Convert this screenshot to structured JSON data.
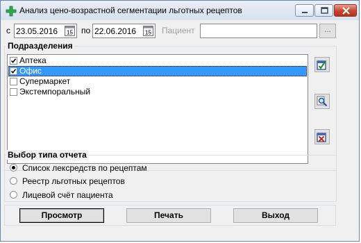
{
  "window": {
    "title": "Анализ цено-возрастной сегментации льготных рецептов"
  },
  "filters": {
    "from_label": "с",
    "from_date": "23.05.2016",
    "to_label": "по",
    "to_date": "22.06.2016",
    "calendar_glyph": "15",
    "patient_label": "Пациент",
    "patient_value": "",
    "browse_label": "..."
  },
  "departments": {
    "title": "Подразделения",
    "items": [
      {
        "label": "Аптека",
        "checked": true
      },
      {
        "label": "Офис",
        "checked": true,
        "selected": true
      },
      {
        "label": "Супермаркет",
        "checked": false
      },
      {
        "label": "Экстемпоральный",
        "checked": false
      }
    ]
  },
  "report_type": {
    "title": "Выбор типа отчета",
    "options": [
      {
        "label": "Список лексредств по рецептам",
        "selected": true
      },
      {
        "label": "Реестр льготных рецептов",
        "selected": false
      },
      {
        "label": "Лицевой счёт пациента",
        "selected": false
      }
    ]
  },
  "buttons": {
    "preview": "Просмотр",
    "print": "Печать",
    "exit": "Выход"
  }
}
